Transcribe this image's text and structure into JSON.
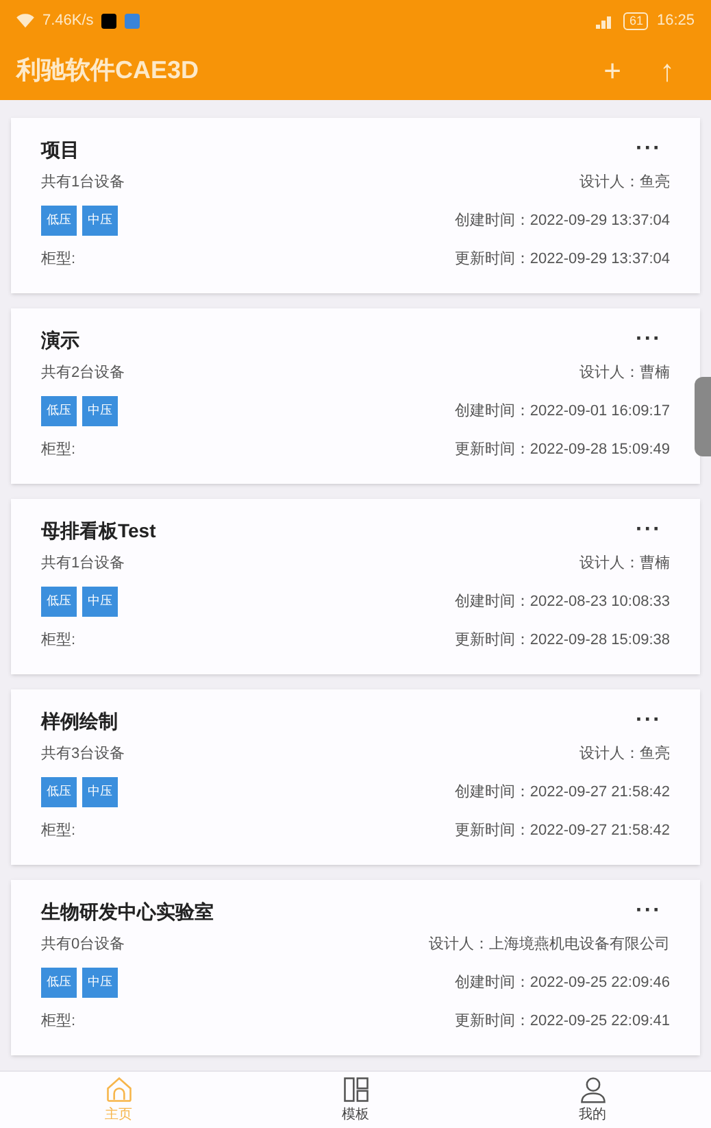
{
  "status_bar": {
    "speed": "7.46K/s",
    "battery": "61",
    "time": "16:25"
  },
  "app_bar": {
    "title": "利驰软件CAE3D",
    "actions": [
      "+",
      "↑"
    ]
  },
  "projects": [
    {
      "title": "项目",
      "count": "共有1台设备",
      "designer": "设计人：鱼亮",
      "tags": [
        "低压",
        "中压"
      ],
      "created": "创建时间：2022-09-29 13:37:04",
      "cabinet": "柜型:",
      "updated": "更新时间：2022-09-29 13:37:04",
      "menu": "···"
    },
    {
      "title": "演示",
      "count": "共有2台设备",
      "designer": "设计人：曹楠",
      "tags": [
        "低压",
        "中压"
      ],
      "created": "创建时间：2022-09-01 16:09:17",
      "cabinet": "柜型:",
      "updated": "更新时间：2022-09-28 15:09:49",
      "menu": "···"
    },
    {
      "title": "母排看板Test",
      "count": "共有1台设备",
      "designer": "设计人：曹楠",
      "tags": [
        "低压",
        "中压"
      ],
      "created": "创建时间：2022-08-23 10:08:33",
      "cabinet": "柜型:",
      "updated": "更新时间：2022-09-28 15:09:38",
      "menu": "···"
    },
    {
      "title": "样例绘制",
      "count": "共有3台设备",
      "designer": "设计人：鱼亮",
      "tags": [
        "低压",
        "中压"
      ],
      "created": "创建时间：2022-09-27 21:58:42",
      "cabinet": "柜型:",
      "updated": "更新时间：2022-09-27 21:58:42",
      "menu": "···"
    },
    {
      "title": "生物研发中心实验室",
      "count": "共有0台设备",
      "designer": "设计人：上海境燕机电设备有限公司",
      "tags": [
        "低压",
        "中压"
      ],
      "created": "创建时间：2022-09-25 22:09:46",
      "cabinet": "柜型:",
      "updated": "更新时间：2022-09-25 22:09:41",
      "menu": "···"
    }
  ],
  "bottom_nav": [
    {
      "label": "主页",
      "kind": "home",
      "selected": true
    },
    {
      "label": "模板",
      "kind": "template",
      "selected": false
    },
    {
      "label": "我的",
      "kind": "profile",
      "selected": false
    }
  ]
}
